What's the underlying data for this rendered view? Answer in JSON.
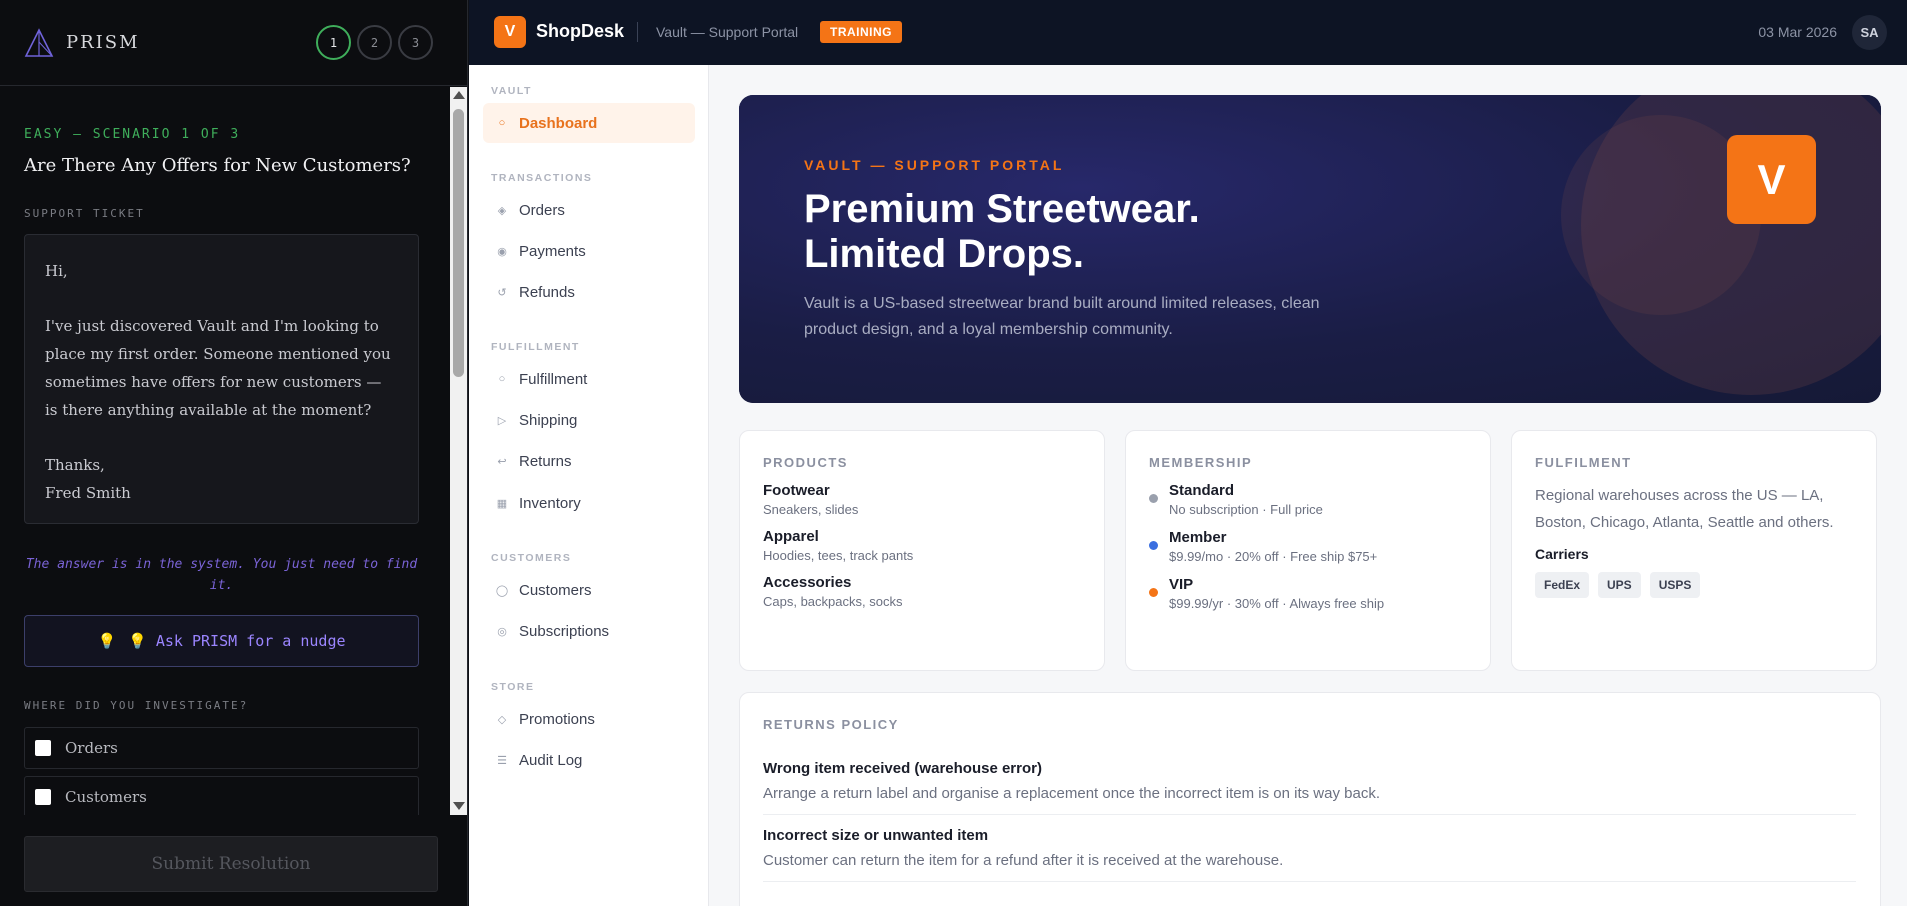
{
  "prism": {
    "title": "PRISM",
    "steps": [
      "1",
      "2",
      "3"
    ],
    "scenario_tag": "EASY — SCENARIO 1 OF 3",
    "scenario_title": "Are There Any Offers for New Customers?",
    "ticket_label": "SUPPORT TICKET",
    "ticket": {
      "greeting": "Hi,",
      "body": "I've just discovered Vault and I'm looking to place my first order. Someone mentioned you sometimes have offers for new customers — is there anything available at the moment?",
      "signoff": "Thanks,",
      "name": "Fred Smith"
    },
    "hint": "The answer is in the system. You just need to find it.",
    "nudge_icon": "💡",
    "nudge_label": "💡 Ask PRISM for a nudge",
    "investigate_label": "WHERE DID YOU INVESTIGATE?",
    "checks": [
      "Orders",
      "Customers"
    ],
    "submit_label": "Submit Resolution"
  },
  "shop": {
    "brand_letter": "V",
    "brand_name": "ShopDesk",
    "portal_label": "Vault — Support Portal",
    "badge": "TRAINING",
    "date": "03 Mar 2026",
    "avatar": "SA",
    "sidebar": {
      "sections": [
        {
          "label": "VAULT",
          "items": [
            {
              "label": "Dashboard",
              "icon": "circle-icon",
              "glyph": "○",
              "active": true
            }
          ]
        },
        {
          "label": "TRANSACTIONS",
          "items": [
            {
              "label": "Orders",
              "icon": "diamond-icon",
              "glyph": "◈"
            },
            {
              "label": "Payments",
              "icon": "radio-icon",
              "glyph": "◉"
            },
            {
              "label": "Refunds",
              "icon": "refresh-icon",
              "glyph": "↺"
            }
          ]
        },
        {
          "label": "FULFILLMENT",
          "items": [
            {
              "label": "Fulfillment",
              "icon": "circle-icon",
              "glyph": "○"
            },
            {
              "label": "Shipping",
              "icon": "play-icon",
              "glyph": "▷"
            },
            {
              "label": "Returns",
              "icon": "return-icon",
              "glyph": "↩"
            },
            {
              "label": "Inventory",
              "icon": "grid-icon",
              "glyph": "▦"
            }
          ]
        },
        {
          "label": "CUSTOMERS",
          "items": [
            {
              "label": "Customers",
              "icon": "user-circle-icon",
              "glyph": "◯"
            },
            {
              "label": "Subscriptions",
              "icon": "target-icon",
              "glyph": "◎"
            }
          ]
        },
        {
          "label": "STORE",
          "items": [
            {
              "label": "Promotions",
              "icon": "diamond-outline-icon",
              "glyph": "◇"
            },
            {
              "label": "Audit Log",
              "icon": "list-icon",
              "glyph": "☰"
            }
          ]
        }
      ]
    },
    "hero": {
      "eyebrow": "VAULT — SUPPORT PORTAL",
      "title_line1": "Premium Streetwear.",
      "title_line2": "Limited Drops.",
      "description": "Vault is a US-based streetwear brand built around limited releases, clean product design, and a loyal membership community.",
      "logo_letter": "V"
    },
    "products": {
      "title": "PRODUCTS",
      "items": [
        {
          "name": "Footwear",
          "sub": "Sneakers, slides"
        },
        {
          "name": "Apparel",
          "sub": "Hoodies, tees, track pants"
        },
        {
          "name": "Accessories",
          "sub": "Caps, backpacks, socks"
        }
      ]
    },
    "membership": {
      "title": "MEMBERSHIP",
      "tiers": [
        {
          "name": "Standard",
          "sub": "No subscription · Full price",
          "color": "#9aa0ad"
        },
        {
          "name": "Member",
          "sub": "$9.99/mo · 20% off · Free ship $75+",
          "color": "#3b6fe0"
        },
        {
          "name": "VIP",
          "sub": "$99.99/yr · 30% off · Always free ship",
          "color": "#f47416"
        }
      ]
    },
    "fulfilment": {
      "title": "FULFILMENT",
      "text": "Regional warehouses across the US — LA, Boston, Chicago, Atlanta, Seattle and others.",
      "carriers_label": "Carriers",
      "carriers": [
        "FedEx",
        "UPS",
        "USPS"
      ]
    },
    "returns": {
      "title": "RETURNS POLICY",
      "items": [
        {
          "title": "Wrong item received (warehouse error)",
          "desc": "Arrange a return label and organise a replacement once the incorrect item is on its way back."
        },
        {
          "title": "Incorrect size or unwanted item",
          "desc": "Customer can return the item for a refund after it is received at the warehouse."
        }
      ]
    }
  }
}
